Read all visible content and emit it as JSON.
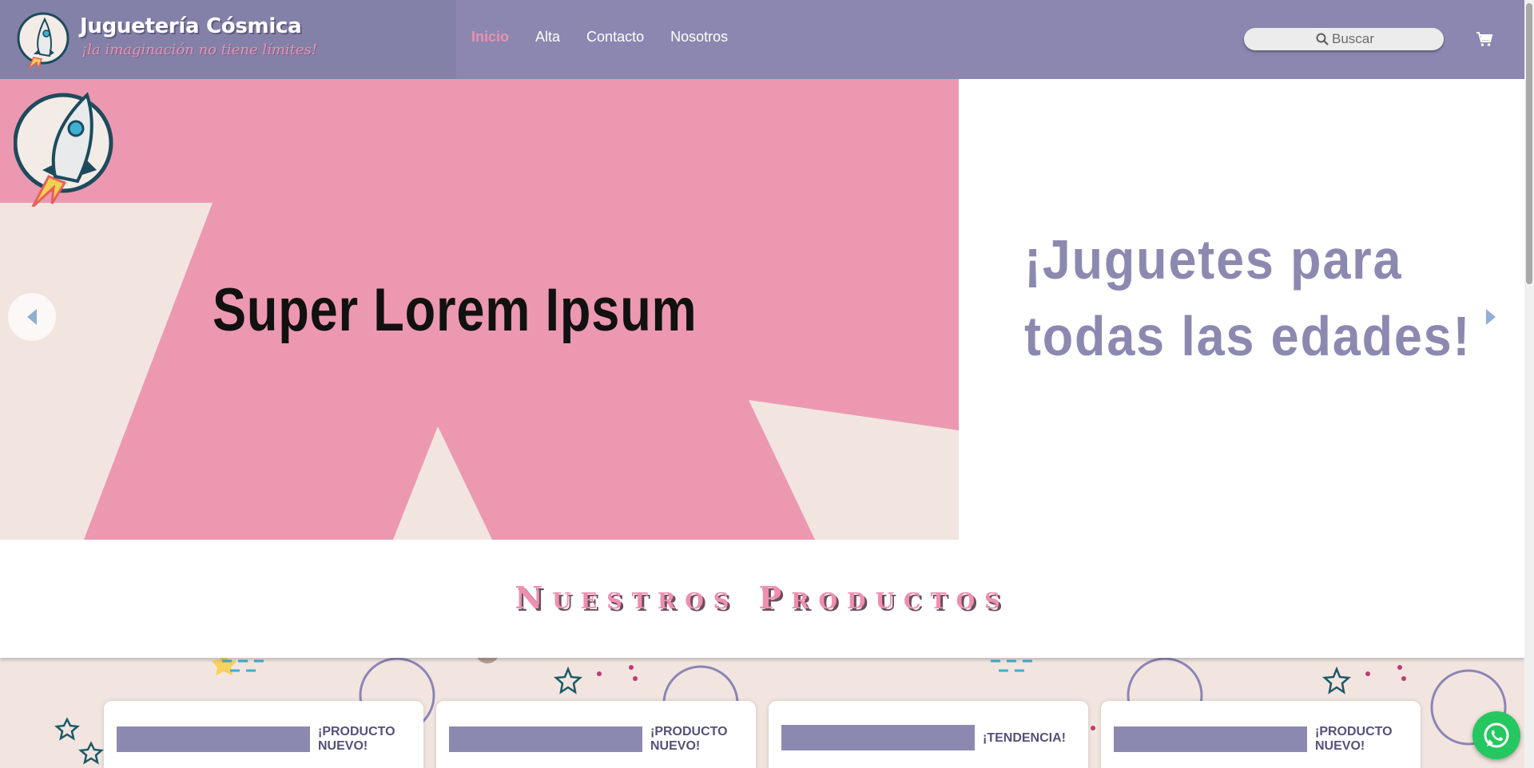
{
  "header": {
    "brand_name": "Juguetería Cósmica",
    "brand_tagline": "¡la imaginación no tiene límites!",
    "logo_icon": "rocket-logo-icon",
    "nav": [
      {
        "label": "Inicio",
        "active": true
      },
      {
        "label": "Alta",
        "active": false
      },
      {
        "label": "Contacto",
        "active": false
      },
      {
        "label": "Nosotros",
        "active": false
      }
    ],
    "search_placeholder": "Buscar",
    "search_icon": "search-icon",
    "cart_icon": "cart-icon"
  },
  "carousel": {
    "slide_title": "Super Lorem Ipsum",
    "right_title_line1": "¡Juguetes para",
    "right_title_line2": "todas las edades!",
    "prev_icon": "chevron-left-icon",
    "next_icon": "chevron-right-icon"
  },
  "products": {
    "section_title": "Nuestros Productos",
    "cards": [
      {
        "badge": "¡PRODUCTO NUEVO!"
      },
      {
        "badge": "¡PRODUCTO NUEVO!"
      },
      {
        "badge": "¡TENDENCIA!"
      },
      {
        "badge": "¡PRODUCTO NUEVO!"
      }
    ]
  },
  "floating": {
    "whatsapp_icon": "whatsapp-icon"
  },
  "colors": {
    "header_bg": "#8b87b0",
    "accent_pink": "#ee8fb1",
    "accent_purple": "#8c89b1",
    "slide_pink": "#ec98b1",
    "cream": "#f2e5e0",
    "whatsapp_green": "#25c760"
  }
}
